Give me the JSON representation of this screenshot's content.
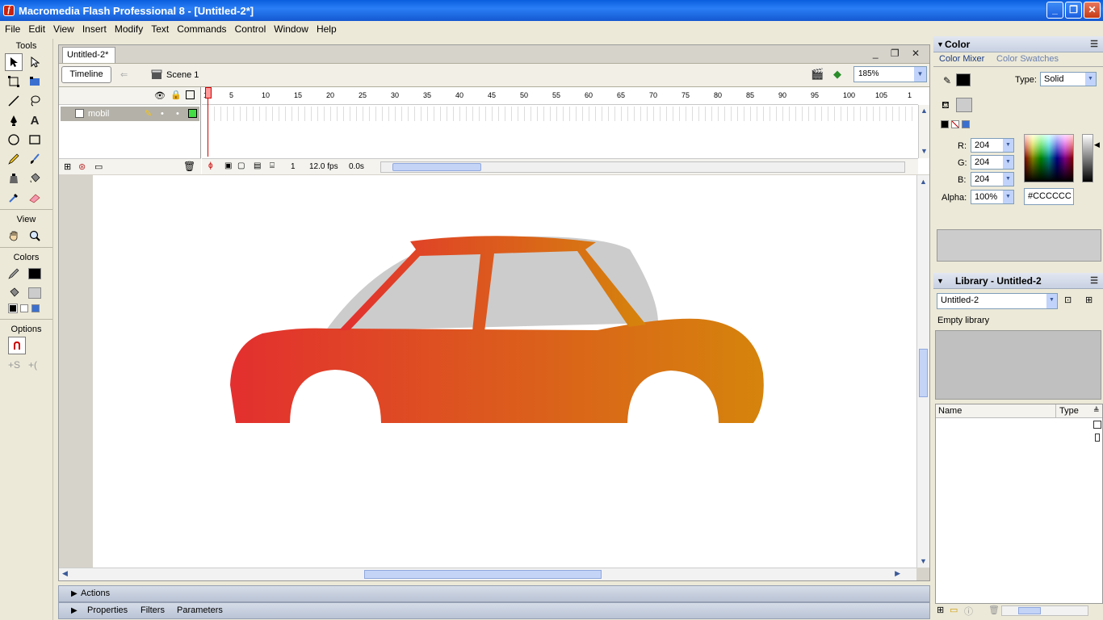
{
  "window": {
    "title": "Macromedia Flash Professional 8 - [Untitled-2*]",
    "app_icon": "f",
    "minimize": "_",
    "maximize": "❐",
    "close": "✕"
  },
  "menu": [
    "File",
    "Edit",
    "View",
    "Insert",
    "Modify",
    "Text",
    "Commands",
    "Control",
    "Window",
    "Help"
  ],
  "tools": {
    "header": "Tools",
    "view_header": "View",
    "colors_header": "Colors",
    "options_header": "Options",
    "icons": [
      "selection-arrow-icon",
      "subselection-icon",
      "free-transform-icon",
      "fill-transform-icon",
      "line-icon",
      "lasso-icon",
      "pen-icon",
      "text-tool-icon",
      "oval-icon",
      "rectangle-icon",
      "pencil-icon",
      "brush-icon",
      "ink-bottle-icon",
      "paint-bucket-icon",
      "eyedropper-icon",
      "eraser-icon"
    ],
    "text_tool": "A"
  },
  "document": {
    "tab": "Untitled-2*",
    "timeline_button": "Timeline",
    "scene": "Scene 1",
    "zoom": "185%"
  },
  "timeline": {
    "layer_name": "mobil",
    "ruler": [
      "1",
      "5",
      "10",
      "15",
      "20",
      "25",
      "30",
      "35",
      "40",
      "45",
      "50",
      "55",
      "60",
      "65",
      "70",
      "75",
      "80",
      "85",
      "90",
      "95",
      "100",
      "105",
      "1"
    ],
    "current_frame": "1",
    "fps": "12.0 fps",
    "elapsed": "0.0s"
  },
  "bottom_panels": {
    "actions": "Actions",
    "properties": "Properties",
    "filters": "Filters",
    "parameters": "Parameters"
  },
  "color_panel": {
    "title": "Color",
    "tab_mixer": "Color Mixer",
    "tab_swatches": "Color Swatches",
    "type_label": "Type:",
    "type_value": "Solid",
    "r_label": "R:",
    "r_value": "204",
    "g_label": "G:",
    "g_value": "204",
    "b_label": "B:",
    "b_value": "204",
    "alpha_label": "Alpha:",
    "alpha_value": "100%",
    "hex_value": "#CCCCCC",
    "fill_color": "#cccccc"
  },
  "library_panel": {
    "title": "Library - Untitled-2",
    "doc_select": "Untitled-2",
    "status": "Empty library",
    "col_name": "Name",
    "col_type": "Type"
  },
  "car": {
    "gradient_start": "#e32f2f",
    "gradient_end": "#d5840c",
    "window_color": "#cccccc"
  }
}
